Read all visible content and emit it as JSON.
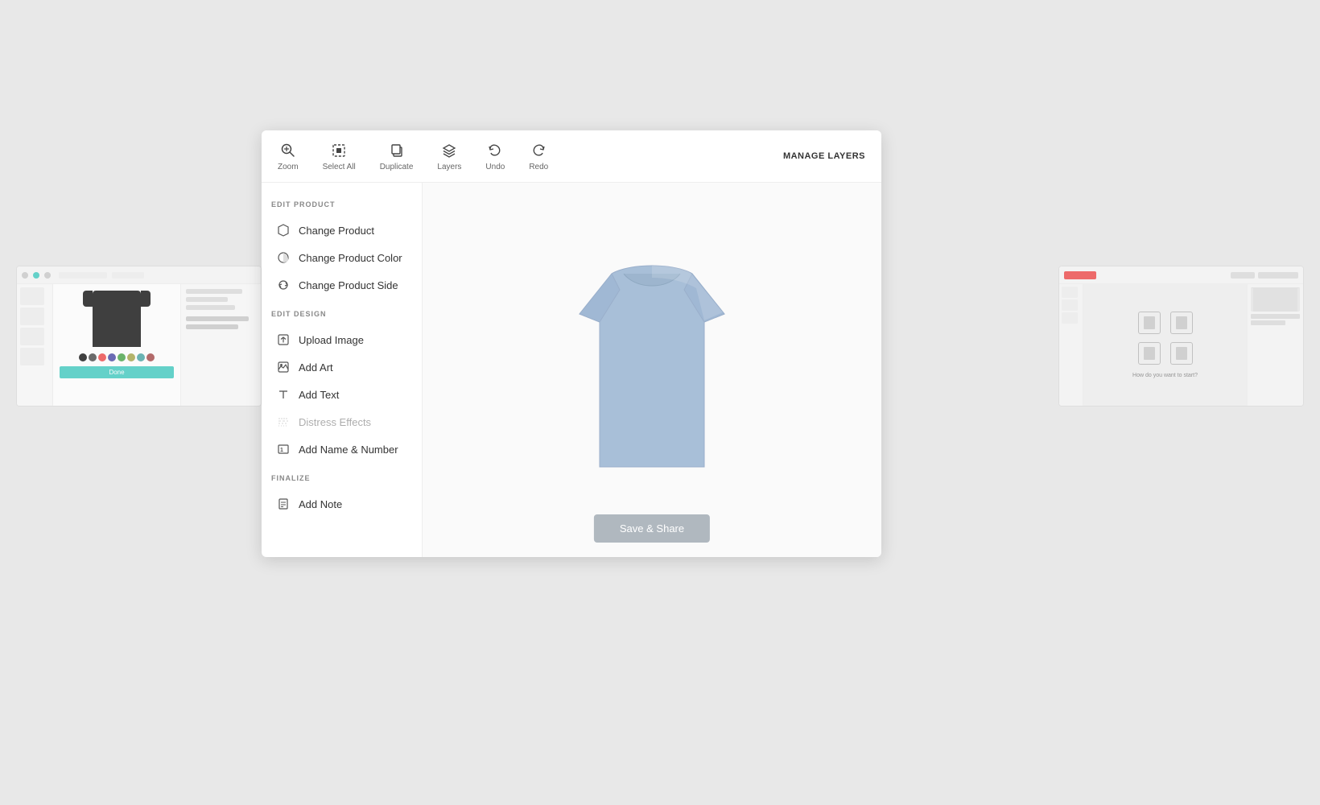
{
  "bg_panel_left": {
    "label": "left-background-panel"
  },
  "bg_panel_right": {
    "label": "right-background-panel"
  },
  "toolbar": {
    "zoom_label": "Zoom",
    "select_all_label": "Select All",
    "duplicate_label": "Duplicate",
    "layers_label": "Layers",
    "undo_label": "Undo",
    "redo_label": "Redo",
    "manage_layers_label": "MANAGE LAYERS"
  },
  "sidebar": {
    "edit_product_label": "EDIT PRODUCT",
    "change_product": "Change Product",
    "change_product_color": "Change Product Color",
    "change_product_side": "Change Product Side",
    "edit_design_label": "EDIT DESIGN",
    "upload_image": "Upload Image",
    "add_art": "Add Art",
    "add_text": "Add Text",
    "distress_effects": "Distress Effects",
    "add_name_number": "Add Name & Number",
    "finalize_label": "FINALIZE",
    "add_note": "Add Note"
  },
  "canvas": {
    "tshirt_color": "#a8c1e0"
  },
  "save_button": {
    "label": "Save & Share"
  }
}
